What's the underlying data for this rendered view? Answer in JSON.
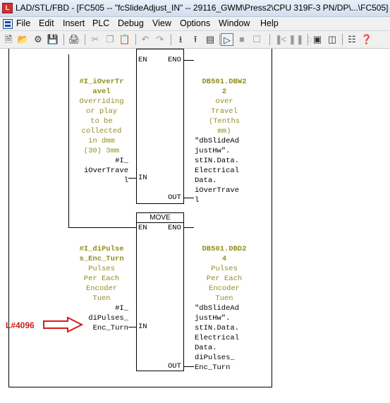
{
  "window": {
    "app_icon_letter": "L",
    "title": "LAD/STL/FBD - [FC505 -- \"fcSlideAdjust_IN\" -- 29116_GWM\\Press2\\CPU 319F-3 PN/DP\\...\\FC505]"
  },
  "menu": [
    "File",
    "Edit",
    "Insert",
    "PLC",
    "Debug",
    "View",
    "Options",
    "Window",
    "Help"
  ],
  "toolbar_icons": [
    "new-icon",
    "open-icon",
    "accessible-nodes-icon",
    "save-icon",
    "print-icon",
    "cut-icon",
    "copy-icon",
    "paste-icon",
    "download-icon",
    "upload-icon",
    "undo-icon",
    "redo-icon",
    "parameter-icon",
    "modify-icon",
    "monitor-icon",
    "network-icon",
    "overview-icon",
    "catalog-icon",
    "help-icon"
  ],
  "colors": {
    "symbol": "#8f8f1f",
    "annotation": "#d21e1e"
  },
  "blocks": [
    {
      "name": "",
      "en": "EN",
      "eno": "ENO",
      "out_label": "OUT",
      "in_label": "IN",
      "input_symbol": "#I_iOverTr\navel",
      "input_comment": "Overriding\nor play\nto be\ncollected\nin dmm\n(30) 3mm",
      "input_address": "#I_\niOverTrave\nl",
      "output_symbol": "DB501.DBW2\n2",
      "output_comment": "over\nTravel\n(Tenths\nmm)",
      "output_address": "\"dbSlideAd\njustHw\".\nstIN.Data.\nElectrical\nData.\niOverTrave\nl"
    },
    {
      "name": "MOVE",
      "en": "EN",
      "eno": "ENO",
      "out_label": "OUT",
      "in_label": "IN",
      "input_symbol": "#I_diPulse\ns_Enc_Turn",
      "input_comment": "Pulses\nPer Each\nEncoder\nTuen",
      "input_address": "#I_\ndiPulses_\nEnc_Turn",
      "output_symbol": "DB501.DBD2\n4",
      "output_comment": "Pulses\nPer Each\nEncoder\nTuen",
      "output_address": "\"dbSlideAd\njustHw\".\nstIN.Data.\nElectrical\nData.\ndiPulses_\nEnc_Turn"
    }
  ],
  "annotation": {
    "text": "L#4096"
  }
}
